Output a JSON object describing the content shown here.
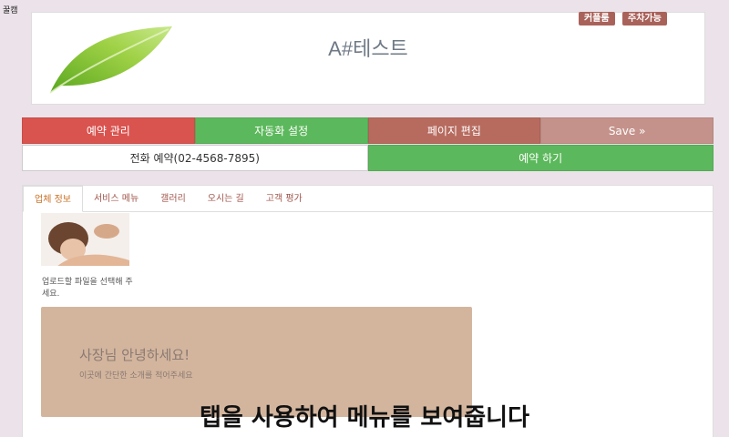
{
  "corner": "꿀캠",
  "header": {
    "title": "A#테스트",
    "badges": [
      "커플룸",
      "주차가능"
    ]
  },
  "buttons": {
    "reservation_manage": "예약 관리",
    "automation_settings": "자동화 설정",
    "page_edit": "페이지 편집",
    "save": "Save »",
    "phone": "전화 예약(02-4568-7895)",
    "book": "예약 하기"
  },
  "tabs": [
    "업체 정보",
    "서비스 메뉴",
    "갤러리",
    "오시는 길",
    "고객 평가"
  ],
  "content": {
    "upload_hint": "업로드할 파일을 선택해 주세요.",
    "greeting": "사장님 안녕하세요!",
    "greeting_sub": "이곳에 간단한 소개를 적어주세요"
  },
  "caption": "탭을 사용하여 메뉴를 보여줍니다",
  "colors": {
    "background": "#ece3ea",
    "red": "#d9534f",
    "green": "#5cb85c",
    "brown": "#b76b5f",
    "rose": "#c4928a",
    "intro_box": "#d3b59e",
    "badge": "#a9625a"
  }
}
